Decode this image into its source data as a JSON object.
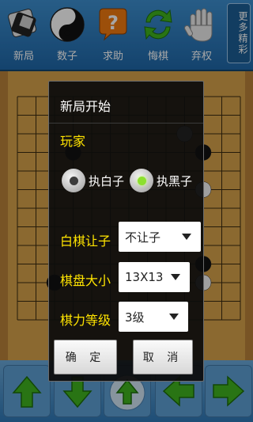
{
  "toolbar": {
    "items": [
      {
        "label": "新局",
        "icon": "new-game-icon"
      },
      {
        "label": "数子",
        "icon": "yin-yang-icon"
      },
      {
        "label": "求助",
        "icon": "help-icon"
      },
      {
        "label": "悔棋",
        "icon": "undo-arrows-icon"
      },
      {
        "label": "弃权",
        "icon": "hand-icon"
      }
    ],
    "more_label": "更多精彩"
  },
  "dialog": {
    "title": "新局开始",
    "player_label": "玩家",
    "radio_white": "执白子",
    "radio_black": "执黑子",
    "selected": "black",
    "handicap_label": "白棋让子",
    "handicap_value": "不让子",
    "board_size_label": "棋盘大小",
    "board_size_value": "13X13",
    "strength_label": "棋力等级",
    "strength_value": "3级",
    "ok": "确 定",
    "cancel": "取 消"
  },
  "bottom_nav": {
    "icons": [
      "arrow-up-icon",
      "arrow-down-icon",
      "home-arrow-icon",
      "arrow-left-icon",
      "arrow-right-icon"
    ]
  },
  "colors": {
    "accent": "#ffe400",
    "toolbar": "#2a6fa8",
    "board": "#d6a14a",
    "radio_dot": "#8ce02f"
  }
}
